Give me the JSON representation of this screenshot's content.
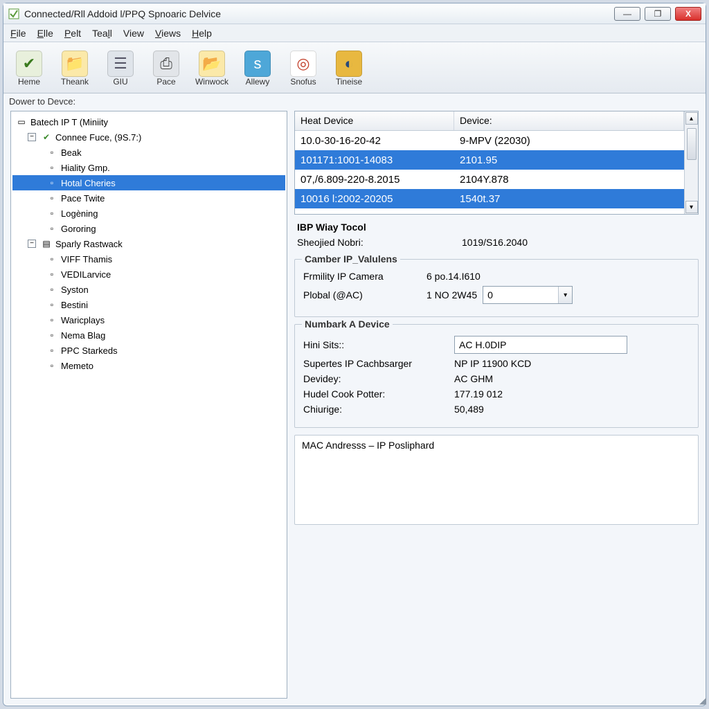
{
  "window": {
    "title": "Connected/Rll Addoid l/PPQ Spnoaric Delvice"
  },
  "menubar": [
    "File",
    "Elle",
    "Pelt",
    "Teall",
    "View",
    "Views",
    "Help"
  ],
  "toolbar": [
    {
      "label": "Heme",
      "icon": "home-check-icon",
      "glyph": "✔",
      "bg": "#e8f0dc",
      "fg": "#3a7a1e"
    },
    {
      "label": "Theank",
      "icon": "folder-arrow-icon",
      "glyph": "📁",
      "bg": "#fbe9a9",
      "fg": "#4a8a20"
    },
    {
      "label": "GIU",
      "icon": "stack-icon",
      "glyph": "☰",
      "bg": "#dfe4ea",
      "fg": "#556"
    },
    {
      "label": "Pace",
      "icon": "printer-icon",
      "glyph": "⎙",
      "bg": "#e2e5e9",
      "fg": "#444"
    },
    {
      "label": "Winwock",
      "icon": "folder-refresh-icon",
      "glyph": "📂",
      "bg": "#fbe9a9",
      "fg": "#b06b18"
    },
    {
      "label": "Allewy",
      "icon": "box-s-icon",
      "glyph": "s",
      "bg": "#4ea7d8",
      "fg": "#fff"
    },
    {
      "label": "Snofus",
      "icon": "target-icon",
      "glyph": "◎",
      "bg": "#fff",
      "fg": "#c23f2a"
    },
    {
      "label": "Tineise",
      "icon": "globe-icon",
      "glyph": "◐",
      "bg": "#e8b840",
      "fg": "#2a4a7a"
    }
  ],
  "panel_label": "Dower to Devce:",
  "tree": {
    "root": "Batech IP T (Miniity",
    "node1": "Connee Fuce,  (9S.7:)",
    "node1_children": [
      "Beak",
      "Hiality Gmp.",
      "Hotal Cheries",
      "Pace Twite",
      "Logèning",
      "Gororing"
    ],
    "node1_selected_index": 2,
    "node2": "Sparly Rastwack",
    "node2_children": [
      "VIFF Thamis",
      "VEDILarvice",
      "Syston",
      "Bestini",
      "Waricplays",
      "Nema Blag",
      "PPC Starkeds",
      "Memeto"
    ]
  },
  "table": {
    "headers": [
      "Heat Device",
      "Device:"
    ],
    "rows": [
      {
        "a": "10.0-30-16-20-42",
        "b": "9-MPV (22030)",
        "sel": false
      },
      {
        "a": "101171:1001-14083",
        "b": "2101.95",
        "sel": true
      },
      {
        "a": "07,/6.809-220-8.2015",
        "b": "2104Y.878",
        "sel": false
      },
      {
        "a": "10016 l:2002-20205",
        "b": "1540t.37",
        "sel": true
      }
    ]
  },
  "ibp": {
    "title": "IBP Wiay Tocol",
    "k1": "Sheojied Nobri:",
    "v1": "1019/S16.2040"
  },
  "camber": {
    "title": "Camber IP_Valulens",
    "k1": "Frmility IP Camera",
    "v1": "6 po.14.I610",
    "k2": "Plobal (@AC)",
    "v2": "1 NO 2W45",
    "combo_value": "0"
  },
  "numbark": {
    "title": "Numbark A Device",
    "k1": "Hini Sits::",
    "input1": "AC H.0DIP",
    "k2": "Supertes IP Cachbsarger",
    "v2": "NP IP 11900 KCD",
    "k3": "Devidey:",
    "v3": "AC GHM",
    "k4": "Hudel Cook Potter:",
    "v4": "177.19 012",
    "k5": "Chiurige:",
    "v5": "50,489"
  },
  "mac": {
    "title": "MAC Andresss – IP Posliphard"
  },
  "winbtns": {
    "min": "—",
    "max": "❐",
    "close": "X"
  }
}
